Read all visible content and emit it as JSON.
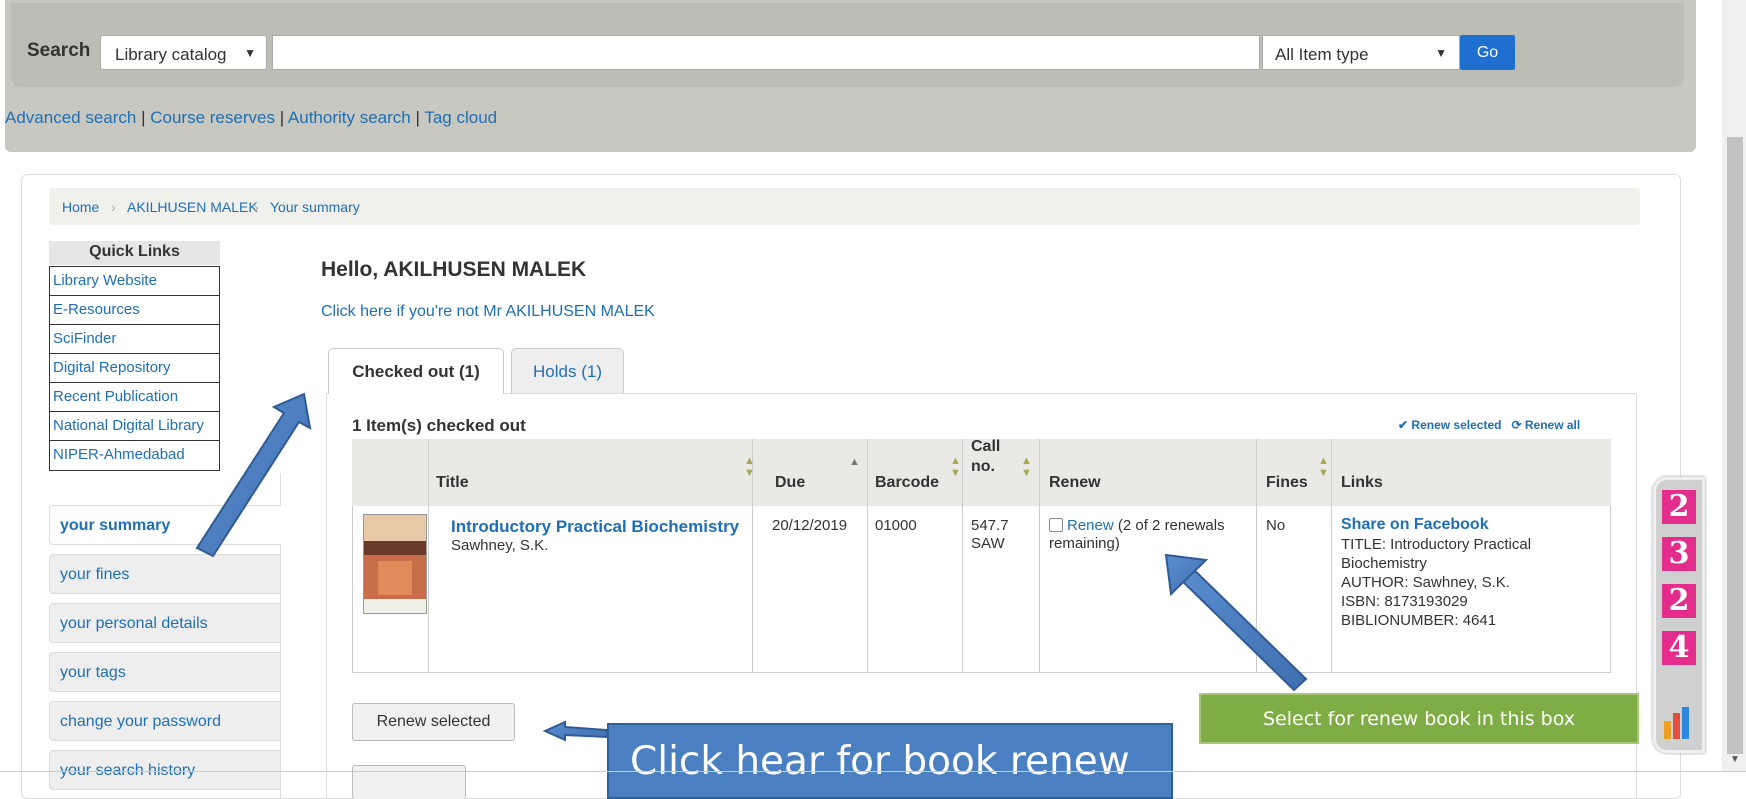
{
  "search": {
    "label": "Search",
    "catalog_select": "Library catalog",
    "item_type_select": "All Item type",
    "go_label": "Go"
  },
  "nav_links": [
    "Advanced search",
    "Course reserves",
    "Authority search",
    "Tag cloud"
  ],
  "breadcrumb": [
    "Home",
    "AKILHUSEN MALEK",
    "Your summary"
  ],
  "quick_links": {
    "title": "Quick Links",
    "items": [
      "Library Website",
      "E-Resources",
      "SciFinder",
      "Digital Repository",
      "Recent Publication",
      "National Digital Library",
      "NIPER-Ahmedabad"
    ]
  },
  "user_menu": [
    "your summary",
    "your fines",
    "your personal details",
    "your tags",
    "change your password",
    "your search history"
  ],
  "greeting": "Hello, AKILHUSEN MALEK",
  "not_me": "Click here if you're not Mr AKILHUSEN MALEK",
  "tabs": [
    "Checked out (1)",
    "Holds (1)"
  ],
  "checked_out": {
    "count_label": "1 Item(s) checked out",
    "renew_selected_link": "Renew selected",
    "renew_all_link": "Renew all",
    "columns": [
      "Title",
      "Due",
      "Barcode",
      "Call no.",
      "Renew",
      "Fines",
      "Links"
    ],
    "rows": [
      {
        "title": "Introductory Practical Biochemistry",
        "author": "Sawhney, S.K.",
        "due": "20/12/2019",
        "barcode": "01000",
        "call_no_1": "547.7",
        "call_no_2": "SAW",
        "renew_link": "Renew",
        "renew_note_1": "(2 of 2 renewals",
        "renew_note_2": "remaining)",
        "fines": "No",
        "share": "Share on Facebook",
        "links": [
          "TITLE: Introductory Practical",
          "Biochemistry",
          "AUTHOR: Sawhney, S.K.",
          "ISBN: 8173193029",
          "BIBLIONUMBER: 4641"
        ]
      }
    ],
    "renew_button": "Renew selected"
  },
  "annotations": {
    "click_hint": "Click hear for book renew",
    "select_hint": "Select for renew book in this box"
  },
  "widget_digits": [
    "2",
    "3",
    "2",
    "4"
  ],
  "colors": {
    "link": "#1f6fb5",
    "go_button": "#1f6fd0",
    "callout_blue": "#4a7fc1",
    "callout_green": "#7fad45",
    "widget_pink": "#e42c8c"
  }
}
